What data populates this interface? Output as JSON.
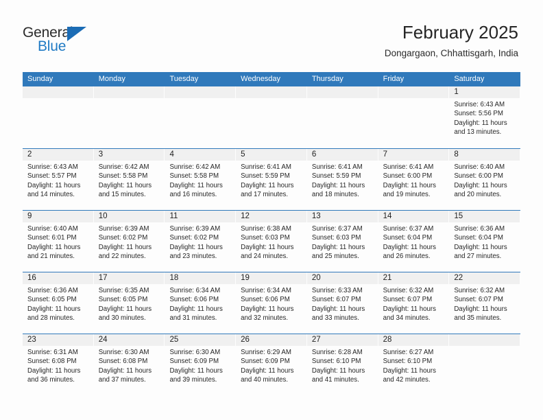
{
  "brand": {
    "name_part1": "General",
    "name_part2": "Blue",
    "triangle_icon": "triangle-icon",
    "accent_color": "#1b6cb5"
  },
  "header": {
    "title": "February 2025",
    "subtitle": "Dongargaon, Chhattisgarh, India"
  },
  "theme": {
    "header_blue": "#3079bb",
    "day_strip_gray": "#f0f0f0",
    "page_background": "#fdfdfd"
  },
  "weekday_headers": [
    "Sunday",
    "Monday",
    "Tuesday",
    "Wednesday",
    "Thursday",
    "Friday",
    "Saturday"
  ],
  "labels": {
    "sunrise_prefix": "Sunrise:",
    "sunset_prefix": "Sunset:",
    "daylight_prefix": "Daylight:"
  },
  "weeks": [
    [
      {
        "day": "",
        "sunrise": "",
        "sunset": "",
        "daylight_line1": "",
        "daylight_line2": ""
      },
      {
        "day": "",
        "sunrise": "",
        "sunset": "",
        "daylight_line1": "",
        "daylight_line2": ""
      },
      {
        "day": "",
        "sunrise": "",
        "sunset": "",
        "daylight_line1": "",
        "daylight_line2": ""
      },
      {
        "day": "",
        "sunrise": "",
        "sunset": "",
        "daylight_line1": "",
        "daylight_line2": ""
      },
      {
        "day": "",
        "sunrise": "",
        "sunset": "",
        "daylight_line1": "",
        "daylight_line2": ""
      },
      {
        "day": "",
        "sunrise": "",
        "sunset": "",
        "daylight_line1": "",
        "daylight_line2": ""
      },
      {
        "day": "1",
        "sunrise": "Sunrise: 6:43 AM",
        "sunset": "Sunset: 5:56 PM",
        "daylight_line1": "Daylight: 11 hours",
        "daylight_line2": "and 13 minutes."
      }
    ],
    [
      {
        "day": "2",
        "sunrise": "Sunrise: 6:43 AM",
        "sunset": "Sunset: 5:57 PM",
        "daylight_line1": "Daylight: 11 hours",
        "daylight_line2": "and 14 minutes."
      },
      {
        "day": "3",
        "sunrise": "Sunrise: 6:42 AM",
        "sunset": "Sunset: 5:58 PM",
        "daylight_line1": "Daylight: 11 hours",
        "daylight_line2": "and 15 minutes."
      },
      {
        "day": "4",
        "sunrise": "Sunrise: 6:42 AM",
        "sunset": "Sunset: 5:58 PM",
        "daylight_line1": "Daylight: 11 hours",
        "daylight_line2": "and 16 minutes."
      },
      {
        "day": "5",
        "sunrise": "Sunrise: 6:41 AM",
        "sunset": "Sunset: 5:59 PM",
        "daylight_line1": "Daylight: 11 hours",
        "daylight_line2": "and 17 minutes."
      },
      {
        "day": "6",
        "sunrise": "Sunrise: 6:41 AM",
        "sunset": "Sunset: 5:59 PM",
        "daylight_line1": "Daylight: 11 hours",
        "daylight_line2": "and 18 minutes."
      },
      {
        "day": "7",
        "sunrise": "Sunrise: 6:41 AM",
        "sunset": "Sunset: 6:00 PM",
        "daylight_line1": "Daylight: 11 hours",
        "daylight_line2": "and 19 minutes."
      },
      {
        "day": "8",
        "sunrise": "Sunrise: 6:40 AM",
        "sunset": "Sunset: 6:00 PM",
        "daylight_line1": "Daylight: 11 hours",
        "daylight_line2": "and 20 minutes."
      }
    ],
    [
      {
        "day": "9",
        "sunrise": "Sunrise: 6:40 AM",
        "sunset": "Sunset: 6:01 PM",
        "daylight_line1": "Daylight: 11 hours",
        "daylight_line2": "and 21 minutes."
      },
      {
        "day": "10",
        "sunrise": "Sunrise: 6:39 AM",
        "sunset": "Sunset: 6:02 PM",
        "daylight_line1": "Daylight: 11 hours",
        "daylight_line2": "and 22 minutes."
      },
      {
        "day": "11",
        "sunrise": "Sunrise: 6:39 AM",
        "sunset": "Sunset: 6:02 PM",
        "daylight_line1": "Daylight: 11 hours",
        "daylight_line2": "and 23 minutes."
      },
      {
        "day": "12",
        "sunrise": "Sunrise: 6:38 AM",
        "sunset": "Sunset: 6:03 PM",
        "daylight_line1": "Daylight: 11 hours",
        "daylight_line2": "and 24 minutes."
      },
      {
        "day": "13",
        "sunrise": "Sunrise: 6:37 AM",
        "sunset": "Sunset: 6:03 PM",
        "daylight_line1": "Daylight: 11 hours",
        "daylight_line2": "and 25 minutes."
      },
      {
        "day": "14",
        "sunrise": "Sunrise: 6:37 AM",
        "sunset": "Sunset: 6:04 PM",
        "daylight_line1": "Daylight: 11 hours",
        "daylight_line2": "and 26 minutes."
      },
      {
        "day": "15",
        "sunrise": "Sunrise: 6:36 AM",
        "sunset": "Sunset: 6:04 PM",
        "daylight_line1": "Daylight: 11 hours",
        "daylight_line2": "and 27 minutes."
      }
    ],
    [
      {
        "day": "16",
        "sunrise": "Sunrise: 6:36 AM",
        "sunset": "Sunset: 6:05 PM",
        "daylight_line1": "Daylight: 11 hours",
        "daylight_line2": "and 28 minutes."
      },
      {
        "day": "17",
        "sunrise": "Sunrise: 6:35 AM",
        "sunset": "Sunset: 6:05 PM",
        "daylight_line1": "Daylight: 11 hours",
        "daylight_line2": "and 30 minutes."
      },
      {
        "day": "18",
        "sunrise": "Sunrise: 6:34 AM",
        "sunset": "Sunset: 6:06 PM",
        "daylight_line1": "Daylight: 11 hours",
        "daylight_line2": "and 31 minutes."
      },
      {
        "day": "19",
        "sunrise": "Sunrise: 6:34 AM",
        "sunset": "Sunset: 6:06 PM",
        "daylight_line1": "Daylight: 11 hours",
        "daylight_line2": "and 32 minutes."
      },
      {
        "day": "20",
        "sunrise": "Sunrise: 6:33 AM",
        "sunset": "Sunset: 6:07 PM",
        "daylight_line1": "Daylight: 11 hours",
        "daylight_line2": "and 33 minutes."
      },
      {
        "day": "21",
        "sunrise": "Sunrise: 6:32 AM",
        "sunset": "Sunset: 6:07 PM",
        "daylight_line1": "Daylight: 11 hours",
        "daylight_line2": "and 34 minutes."
      },
      {
        "day": "22",
        "sunrise": "Sunrise: 6:32 AM",
        "sunset": "Sunset: 6:07 PM",
        "daylight_line1": "Daylight: 11 hours",
        "daylight_line2": "and 35 minutes."
      }
    ],
    [
      {
        "day": "23",
        "sunrise": "Sunrise: 6:31 AM",
        "sunset": "Sunset: 6:08 PM",
        "daylight_line1": "Daylight: 11 hours",
        "daylight_line2": "and 36 minutes."
      },
      {
        "day": "24",
        "sunrise": "Sunrise: 6:30 AM",
        "sunset": "Sunset: 6:08 PM",
        "daylight_line1": "Daylight: 11 hours",
        "daylight_line2": "and 37 minutes."
      },
      {
        "day": "25",
        "sunrise": "Sunrise: 6:30 AM",
        "sunset": "Sunset: 6:09 PM",
        "daylight_line1": "Daylight: 11 hours",
        "daylight_line2": "and 39 minutes."
      },
      {
        "day": "26",
        "sunrise": "Sunrise: 6:29 AM",
        "sunset": "Sunset: 6:09 PM",
        "daylight_line1": "Daylight: 11 hours",
        "daylight_line2": "and 40 minutes."
      },
      {
        "day": "27",
        "sunrise": "Sunrise: 6:28 AM",
        "sunset": "Sunset: 6:10 PM",
        "daylight_line1": "Daylight: 11 hours",
        "daylight_line2": "and 41 minutes."
      },
      {
        "day": "28",
        "sunrise": "Sunrise: 6:27 AM",
        "sunset": "Sunset: 6:10 PM",
        "daylight_line1": "Daylight: 11 hours",
        "daylight_line2": "and 42 minutes."
      },
      {
        "day": "",
        "sunrise": "",
        "sunset": "",
        "daylight_line1": "",
        "daylight_line2": ""
      }
    ]
  ]
}
